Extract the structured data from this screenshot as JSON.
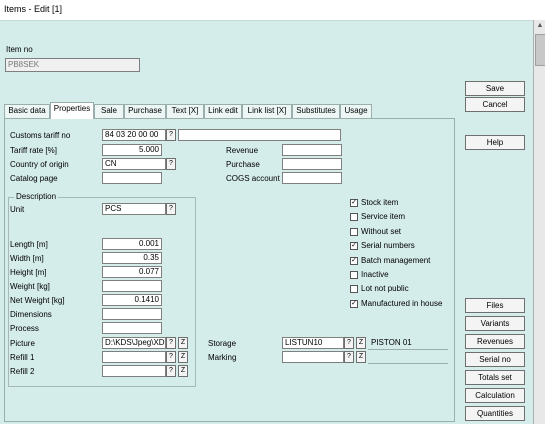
{
  "window": {
    "title": "Items - Edit [1]"
  },
  "header": {
    "item_no_label": "Item no",
    "item_no_value": "PB8SEK"
  },
  "actions": {
    "save": "Save",
    "cancel": "Cancel",
    "help": "Help",
    "side": [
      "Files",
      "Variants",
      "Revenues",
      "Serial no",
      "Totals set",
      "Calculation",
      "Quantities"
    ]
  },
  "tabs": [
    "Basic data",
    "Properties",
    "Sale",
    "Purchase",
    "Text [X]",
    "Link edit",
    "Link list [X]",
    "Substitutes",
    "Usage"
  ],
  "active_tab": "Properties",
  "fields": {
    "customs_tariff": {
      "label": "Customs tariff no",
      "value": "84 03 20 00 00",
      "button": "?"
    },
    "tariff_rate": {
      "label": "Tariff rate [%]",
      "value": "5.000"
    },
    "country_origin": {
      "label": "Country of origin",
      "value": "CN",
      "button": "?"
    },
    "catalog_page": {
      "label": "Catalog page",
      "value": ""
    },
    "revenue": {
      "label": "Revenue",
      "value": ""
    },
    "purchase": {
      "label": "Purchase",
      "value": ""
    },
    "cogs": {
      "label": "COGS account",
      "value": ""
    }
  },
  "description": {
    "title": "Description",
    "unit": {
      "label": "Unit",
      "value": "PCS",
      "button": "?"
    },
    "length": {
      "label": "Length [m]",
      "value": "0.001"
    },
    "width": {
      "label": "Width [m]",
      "value": "0.35"
    },
    "height": {
      "label": "Height [m]",
      "value": "0.077"
    },
    "weight": {
      "label": "Weight [kg]",
      "value": ""
    },
    "net_weight": {
      "label": "Net Weight [kg]",
      "value": "0.1410"
    },
    "dimensions": {
      "label": "Dimensions",
      "value": ""
    },
    "process": {
      "label": "Process",
      "value": ""
    },
    "picture": {
      "label": "Picture",
      "value": "D:\\KDS\\Jpeg\\XDOD"
    },
    "refill1": {
      "label": "Refill 1",
      "value": ""
    },
    "refill2": {
      "label": "Refill 2",
      "value": ""
    }
  },
  "storage": {
    "label": "Storage",
    "value": "LISTUN10",
    "extra": "PISTON 01"
  },
  "marking": {
    "label": "Marking",
    "value": ""
  },
  "checkboxes": [
    {
      "label": "Stock item",
      "checked": true
    },
    {
      "label": "Service item",
      "checked": false
    },
    {
      "label": "Without set",
      "checked": false
    },
    {
      "label": "Serial numbers",
      "checked": true
    },
    {
      "label": "Batch management",
      "checked": true
    },
    {
      "label": "Inactive",
      "checked": false
    },
    {
      "label": "Lot not public",
      "checked": false
    },
    {
      "label": "Manufactured in house",
      "checked": true
    }
  ],
  "glyphs": {
    "check": "✓",
    "help_q": "?",
    "edit": "Z",
    "scroll_up": "▲",
    "scroll_down": "▼"
  }
}
